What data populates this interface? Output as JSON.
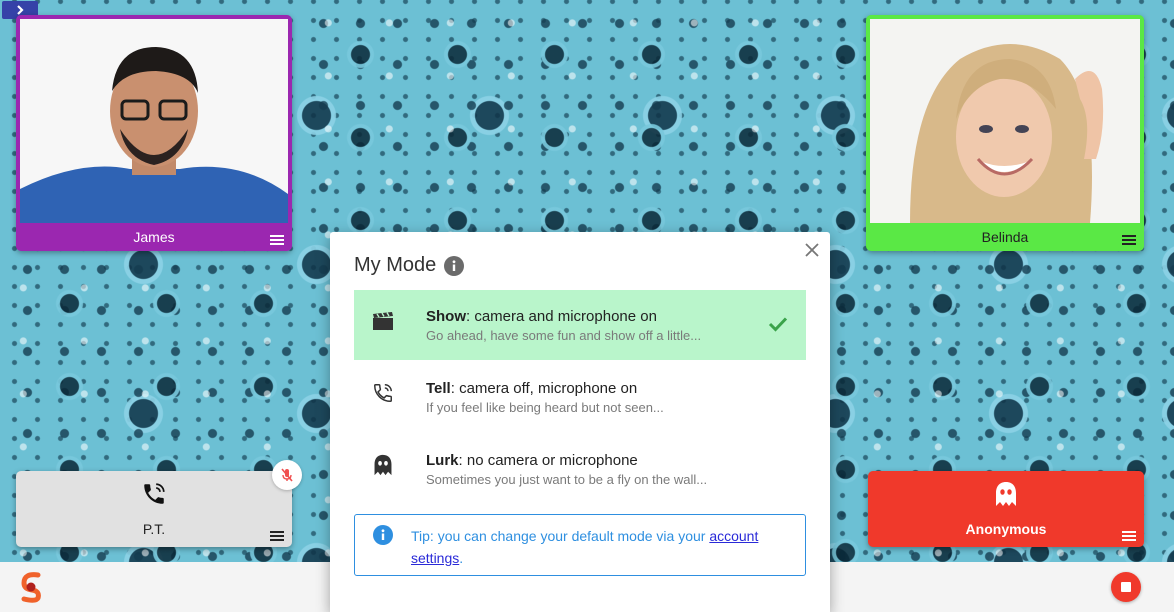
{
  "participants": {
    "james": {
      "name": "James"
    },
    "belinda": {
      "name": "Belinda"
    },
    "pt": {
      "name": "P.T."
    },
    "anonymous": {
      "name": "Anonymous"
    }
  },
  "modal": {
    "title": "My Mode",
    "options": [
      {
        "label": "Show",
        "desc": ": camera and microphone on",
        "sub": "Go ahead, have some fun and show off a little...",
        "selected": true,
        "icon": "clapperboard-icon"
      },
      {
        "label": "Tell",
        "desc": ": camera off, microphone on",
        "sub": "If you feel like being heard but not seen...",
        "selected": false,
        "icon": "phone-icon"
      },
      {
        "label": "Lurk",
        "desc": ": no camera or microphone",
        "sub": "Sometimes you just want to be a fly on the wall...",
        "selected": false,
        "icon": "ghost-icon"
      }
    ],
    "tip": {
      "prefix": "Tip: you can change your default mode via your ",
      "link1": "account",
      "link2": "settings",
      "suffix": "."
    }
  },
  "colors": {
    "james_border": "#9b27b0",
    "belinda_border": "#5ae845",
    "anonymous_bg": "#f0392b",
    "selected_bg": "#b9f5cb",
    "tip_blue": "#2e8fe0"
  }
}
